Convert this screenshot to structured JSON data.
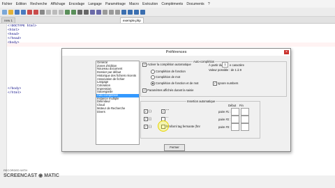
{
  "menu": [
    "Fichier",
    "Edition",
    "Recherche",
    "Affichage",
    "Encodage",
    "Langage",
    "Paramétrage",
    "Macro",
    "Exécution",
    "Compléments",
    "Documents",
    "?"
  ],
  "tabs": [
    "new 1",
    "exemple.php"
  ],
  "code_lines": [
    "<!DOCTYPE html>",
    "<html>",
    "<head>",
    "</head>",
    "<body>",
    "",
    "",
    "",
    "",
    "",
    "",
    "",
    "",
    "",
    "",
    "</body>",
    "</html>"
  ],
  "dialog": {
    "title": "Préférences",
    "close": "×",
    "categories": [
      "Général",
      "Zones d'édition",
      "Nouveau document",
      "Dossier par défaut",
      "Historique des fichiers récents",
      "Association de fichier",
      "Langage",
      "Coloration",
      "Impression",
      "Sauvegarde",
      "Auto-complétion",
      "Instance multiple",
      "Délimiteur",
      "Cloud",
      "Moteur de Recherche",
      "Divers"
    ],
    "selected_index": 10,
    "auto": {
      "legend": "Auto-complétion",
      "enable_label": "Activer la complétion automatique",
      "from_label": "À partir du",
      "from_value": "1",
      "from_suffix": "e caractère",
      "valid_range": "Valeur possible : de 1 à 9",
      "radio_function": "Complétion de fonction",
      "radio_word": "Complétion de mot",
      "radio_both": "Complétion de fonction et de mot",
      "ignore_numbers": "Ignore numbers",
      "params_hint": "Paramètres affichés durant la saisie"
    },
    "insert": {
      "legend": "Insertion automatique",
      "col_start": "Début",
      "col_end": "Fin",
      "row1": "( )",
      "row1b": "\" \"",
      "row2": "[ ]",
      "row2b": "' '",
      "row3": "{ }",
      "row3b": "html/xml tag fermante (fmr",
      "pair1": "paire #1 :",
      "pair2": "paire #2 :",
      "pair3": "paire #3 :"
    },
    "close_button": "Fermer"
  },
  "watermark": {
    "small": "RECORDED WITH",
    "big": "SCREENCAST ◉ MATIC"
  }
}
